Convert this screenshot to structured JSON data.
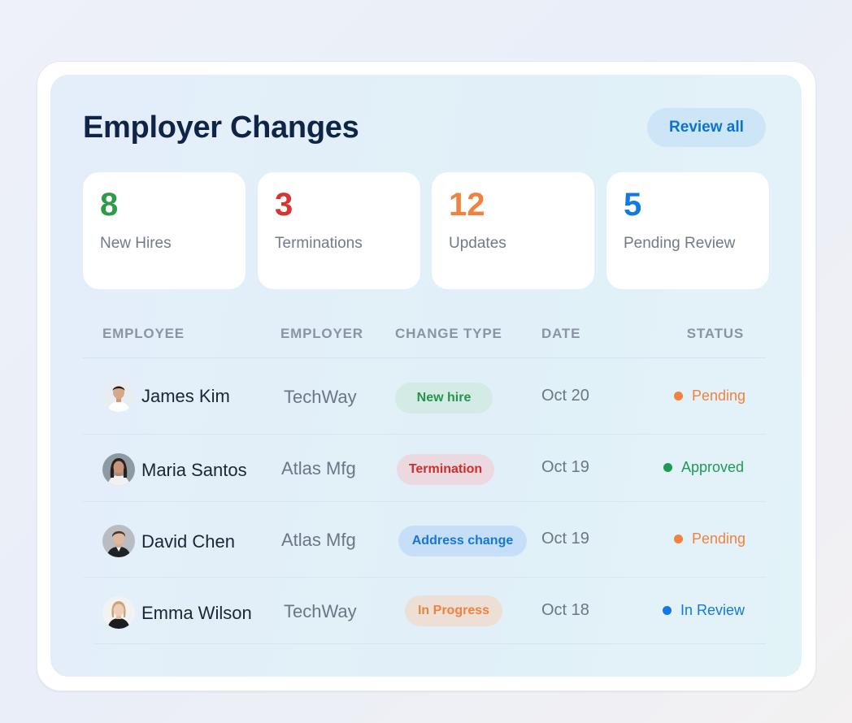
{
  "header": {
    "title": "Employer Changes",
    "review_label": "Review all"
  },
  "stats": [
    {
      "value": "8",
      "label": "New Hires",
      "color": "#2e9a4a"
    },
    {
      "value": "3",
      "label": "Terminations",
      "color": "#d9342f"
    },
    {
      "value": "12",
      "label": "Updates",
      "color": "#f0823e"
    },
    {
      "value": "5",
      "label": "Pending Review",
      "color": "#1379e0"
    }
  ],
  "table": {
    "columns": [
      "EMPLOYEE",
      "EMPLOYER",
      "CHANGE TYPE",
      "DATE",
      "STATUS"
    ],
    "rows": [
      {
        "name": "James Kim",
        "employer": "TechWay",
        "change": "New hire",
        "date": "Oct 20",
        "status": "Pending"
      },
      {
        "name": "Maria Santos",
        "employer": "Atlas Mfg",
        "change": "Termination",
        "date": "Oct 19",
        "status": "Approved"
      },
      {
        "name": "David Chen",
        "employer": "Atlas Mfg",
        "change": "Address change",
        "date": "Oct 19",
        "status": "Pending"
      },
      {
        "name": "Emma Wilson",
        "employer": "TechWay",
        "change": "In Progress",
        "date": "Oct 18",
        "status": "In Review"
      }
    ]
  },
  "colors": {
    "pending": "#f0823e",
    "approved": "#1e9a55",
    "in_review": "#1379e0",
    "title": "#0f2547",
    "accent": "#0b73d1"
  }
}
